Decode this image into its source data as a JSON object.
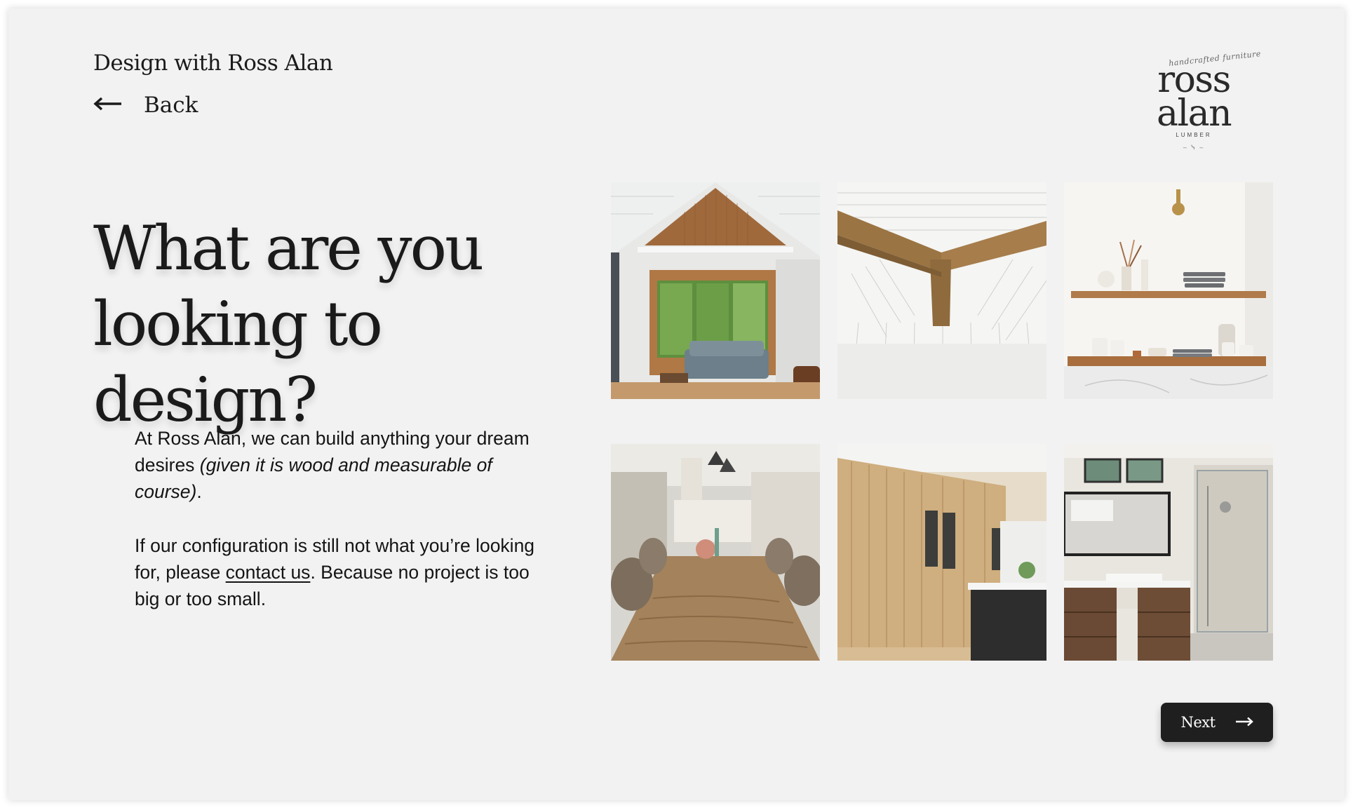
{
  "header": {
    "title": "Design with Ross Alan",
    "back_label": "Back",
    "back_icon": "arrow-left-icon"
  },
  "logo": {
    "script": "handcrafted furniture",
    "name": "ross alan",
    "sub": "LUMBER"
  },
  "main": {
    "headline": "What are you looking to design?",
    "para1_text": "At Ross Alan, we can build anything your dream desires ",
    "para1_italic": "(given it is wood and measurable of course)",
    "para1_end": ".",
    "para2_start": "If our configuration is still not what you’re looking for, please ",
    "para2_link": "contact us",
    "para2_end": ". Because no project is too big or too small."
  },
  "gallery": {
    "tiles": [
      "living-room-wood-wall",
      "ceiling-wood-beams",
      "kitchen-floating-shelves",
      "dining-live-edge-table",
      "wood-cabinet-wall",
      "bathroom-wood-vanity"
    ]
  },
  "footer": {
    "next_label": "Next",
    "next_icon": "arrow-right-icon"
  },
  "colors": {
    "background": "#f2f2f2",
    "text": "#1a1a1a",
    "button": "#1e1f1e",
    "button_text": "#ffffff"
  }
}
